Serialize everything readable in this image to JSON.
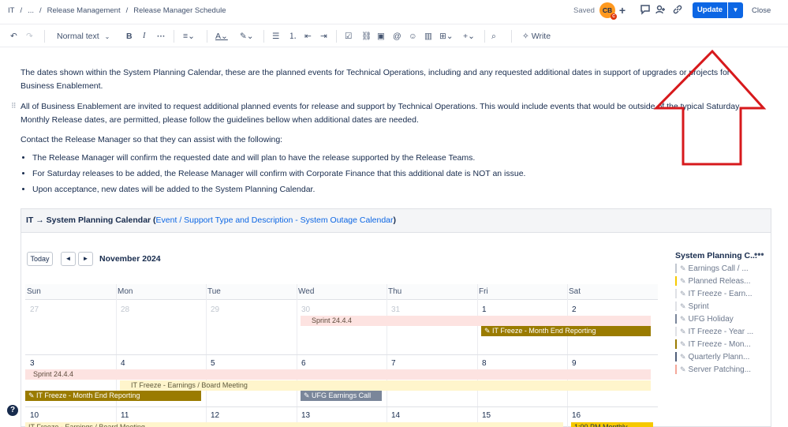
{
  "breadcrumb": [
    "IT",
    "...",
    "Release Management",
    "Release Manager Schedule"
  ],
  "header": {
    "saved_label": "Saved",
    "avatar_initials": "CB",
    "avatar_badge": "C",
    "update_label": "Update",
    "close_label": "Close"
  },
  "toolbar": {
    "text_style": "Normal text",
    "write_label": "Write"
  },
  "content": {
    "para1": "The dates shown within the System Planning Calendar, these are the planned events for Technical Operations, including and any requested additional dates in support of upgrades or projects for Business Enablement.",
    "para2": "All of Business Enablement are invited to request additional planned events for release and support by Technical Operations. This would include events that would be outside of the typical Saturday Monthly Release dates,  are permitted, please follow the guidelines bellow when additional dates are needed.",
    "para3": "Contact the Release Manager so that they can assist with the following:",
    "bullets": [
      "The Release Manager will confirm the requested date and will plan to have the release supported by the Release Teams.",
      "For Saturday releases to be added, the Release Manager will confirm with Corporate Finance that this additional date is NOT an issue.",
      "Upon acceptance, new dates will be added to the System Planning Calendar."
    ]
  },
  "macro": {
    "title": "IT → System Planning Calendar (",
    "link": "Event / Support Type and Description - System Outage Calendar",
    "close_paren": ")"
  },
  "calendar": {
    "today_label": "Today",
    "prev_label": "◄",
    "next_label": "►",
    "month": "November 2024",
    "weekdays": [
      "Sun",
      "Mon",
      "Tue",
      "Wed",
      "Thu",
      "Fri",
      "Sat"
    ],
    "week1": [
      "27",
      "28",
      "29",
      "30",
      "31",
      "1",
      "2"
    ],
    "week2": [
      "3",
      "4",
      "5",
      "6",
      "7",
      "8",
      "9"
    ],
    "week3": [
      "10",
      "11",
      "12",
      "13",
      "14",
      "15",
      "16"
    ],
    "events": {
      "sprint1": "Sprint 24.4.4",
      "freeze1": "IT Freeze - Month End Reporting",
      "sprint2": "Sprint 24.4.4",
      "earnings": "IT Freeze - Earnings / Board Meeting",
      "freeze2": "IT Freeze - Month End Reporting",
      "holiday": "UFG Earnings Call",
      "earnings2": "IT Freeze - Earnings / Board Meeting",
      "qtr": "1:00 PM Monthly"
    }
  },
  "sidebar": {
    "title": "System Planning C...",
    "items": [
      {
        "label": "Earnings Call / ...",
        "color": "#c1c7d0"
      },
      {
        "label": "Planned Releas...",
        "color": "#f6c900"
      },
      {
        "label": "IT Freeze - Earn...",
        "color": "#dfe1e6"
      },
      {
        "label": "Sprint",
        "color": "#dfe1e6"
      },
      {
        "label": "UFG Holiday",
        "color": "#7a869a"
      },
      {
        "label": "IT Freeze - Year ...",
        "color": "#dfe1e6"
      },
      {
        "label": "IT Freeze - Mon...",
        "color": "#9a7b00"
      },
      {
        "label": "Quarterly Plann...",
        "color": "#505f79"
      },
      {
        "label": "Server Patching...",
        "color": "#f4a89a"
      }
    ]
  },
  "colors": {
    "accent": "#0c66e4",
    "annotation_arrow": "#d7191c"
  }
}
